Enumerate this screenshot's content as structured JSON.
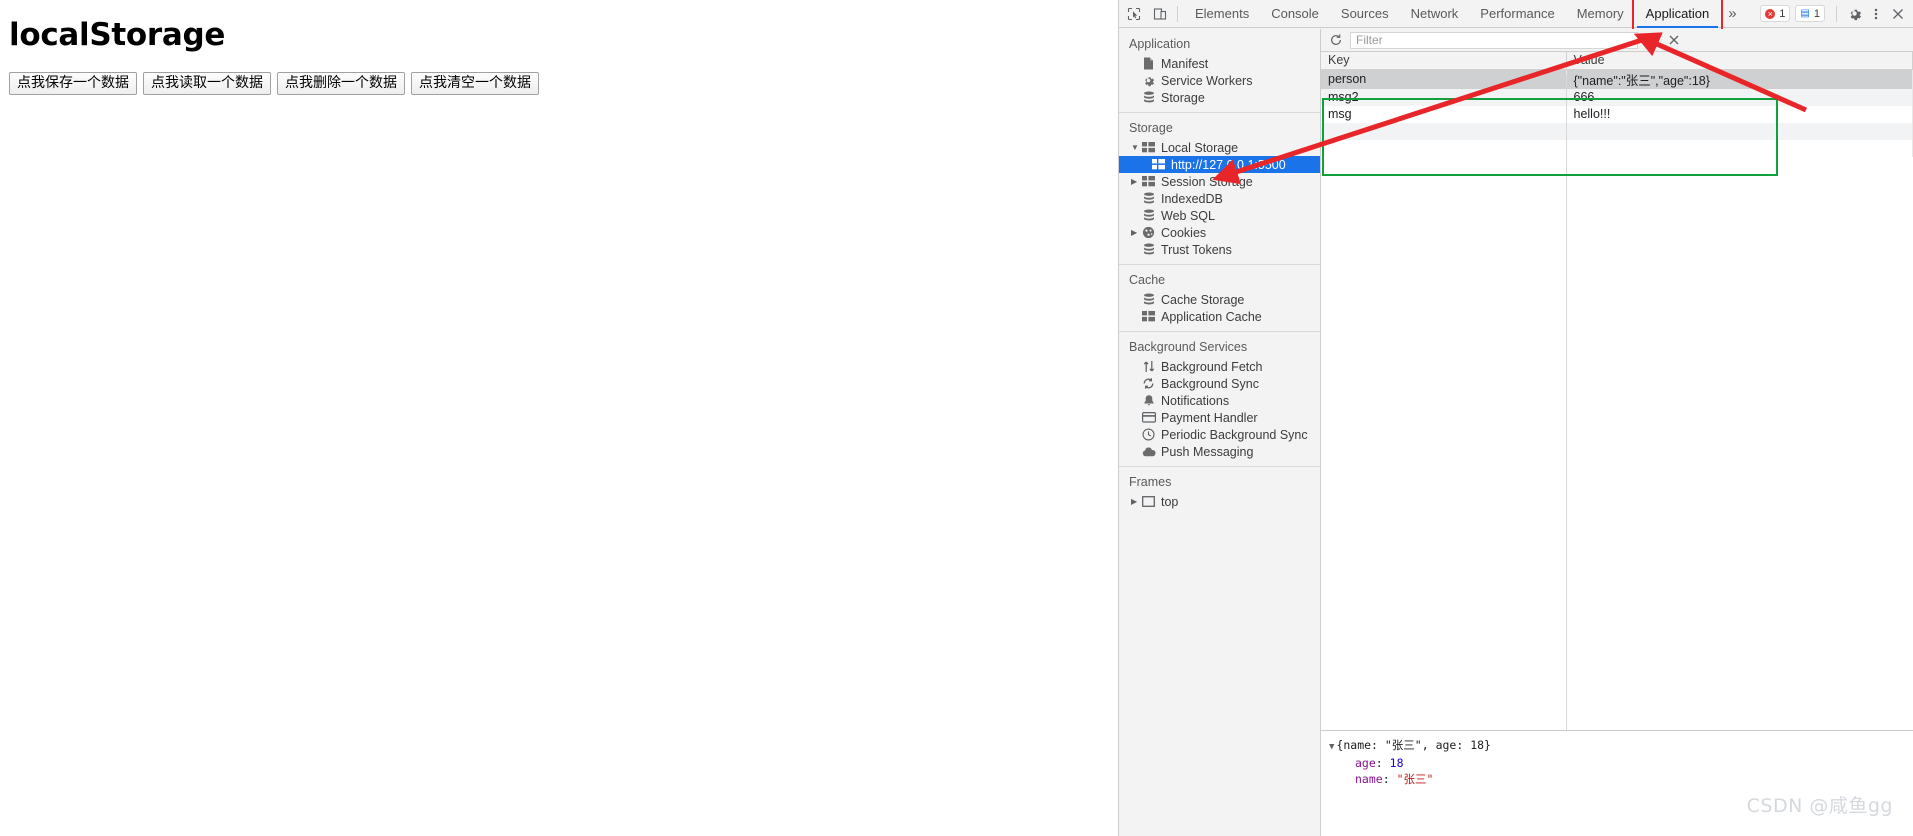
{
  "page": {
    "title": "localStorage",
    "buttons": [
      {
        "label": "点我保存一个数据",
        "name": "save-data-button"
      },
      {
        "label": "点我读取一个数据",
        "name": "read-data-button"
      },
      {
        "label": "点我删除一个数据",
        "name": "delete-data-button"
      },
      {
        "label": "点我清空一个数据",
        "name": "clear-data-button"
      }
    ]
  },
  "devtools": {
    "toolbar_left_icons": [
      "inspect-element-icon",
      "device-toolbar-icon"
    ],
    "tabs": [
      {
        "label": "Elements",
        "active": false
      },
      {
        "label": "Console",
        "active": false
      },
      {
        "label": "Sources",
        "active": false
      },
      {
        "label": "Network",
        "active": false
      },
      {
        "label": "Performance",
        "active": false
      },
      {
        "label": "Memory",
        "active": false
      },
      {
        "label": "Application",
        "active": true
      }
    ],
    "more_tabs": "»",
    "errors": {
      "icon": "error-icon",
      "count": "1"
    },
    "messages": {
      "icon": "message-icon",
      "count": "1"
    },
    "settings_icon": "gear-icon",
    "kebab_icon": "more-options-icon",
    "close_icon": "close-icon",
    "highlight_color": "#e8262a",
    "accent_color": "#1a73e8"
  },
  "sidebar": {
    "groups": [
      {
        "head": "Application",
        "items": [
          {
            "label": "Manifest",
            "icon": "manifest-file-icon",
            "indent": 0,
            "twisty": "",
            "selected": false
          },
          {
            "label": "Service Workers",
            "icon": "gear-icon",
            "indent": 0,
            "twisty": "",
            "selected": false
          },
          {
            "label": "Storage",
            "icon": "database-icon",
            "indent": 0,
            "twisty": "",
            "selected": false
          }
        ]
      },
      {
        "head": "Storage",
        "items": [
          {
            "label": "Local Storage",
            "icon": "table-grid-icon",
            "indent": 0,
            "twisty": "▼",
            "selected": false
          },
          {
            "label": "http://127.0.0.1:5500",
            "icon": "table-grid-icon",
            "indent": 1,
            "twisty": "",
            "selected": true
          },
          {
            "label": "Session Storage",
            "icon": "table-grid-icon",
            "indent": 0,
            "twisty": "▶",
            "selected": false
          },
          {
            "label": "IndexedDB",
            "icon": "database-icon",
            "indent": 0,
            "twisty": "",
            "selected": false
          },
          {
            "label": "Web SQL",
            "icon": "database-icon",
            "indent": 0,
            "twisty": "",
            "selected": false
          },
          {
            "label": "Cookies",
            "icon": "cookie-icon",
            "indent": 0,
            "twisty": "▶",
            "selected": false
          },
          {
            "label": "Trust Tokens",
            "icon": "database-icon",
            "indent": 0,
            "twisty": "",
            "selected": false
          }
        ]
      },
      {
        "head": "Cache",
        "items": [
          {
            "label": "Cache Storage",
            "icon": "database-icon",
            "indent": 0,
            "twisty": "",
            "selected": false
          },
          {
            "label": "Application Cache",
            "icon": "table-grid-icon",
            "indent": 0,
            "twisty": "",
            "selected": false
          }
        ]
      },
      {
        "head": "Background Services",
        "items": [
          {
            "label": "Background Fetch",
            "icon": "arrows-updown-icon",
            "indent": 0,
            "twisty": "",
            "selected": false
          },
          {
            "label": "Background Sync",
            "icon": "sync-icon",
            "indent": 0,
            "twisty": "",
            "selected": false
          },
          {
            "label": "Notifications",
            "icon": "bell-icon",
            "indent": 0,
            "twisty": "",
            "selected": false
          },
          {
            "label": "Payment Handler",
            "icon": "credit-card-icon",
            "indent": 0,
            "twisty": "",
            "selected": false
          },
          {
            "label": "Periodic Background Sync",
            "icon": "clock-icon",
            "indent": 0,
            "twisty": "",
            "selected": false
          },
          {
            "label": "Push Messaging",
            "icon": "cloud-icon",
            "indent": 0,
            "twisty": "",
            "selected": false
          }
        ]
      },
      {
        "head": "Frames",
        "items": [
          {
            "label": "top",
            "icon": "frame-icon",
            "indent": 0,
            "twisty": "▶",
            "selected": false
          }
        ]
      }
    ]
  },
  "storage_toolbar": {
    "refresh_icon": "refresh-icon",
    "filter_placeholder": "Filter",
    "filter_value": "",
    "clear_all_icon": "clear-all-icon",
    "delete_selected_icon": "delete-selected-icon"
  },
  "kv_table": {
    "columns": [
      "Key",
      "Value"
    ],
    "rows": [
      {
        "key": "person",
        "value": "{\"name\":\"张三\",\"age\":18}",
        "selected": true
      },
      {
        "key": "msg2",
        "value": "666",
        "selected": false
      },
      {
        "key": "msg",
        "value": "hello!!!",
        "selected": false
      }
    ],
    "highlight_color": "#12a03c"
  },
  "preview": {
    "root_twisty": "▼",
    "root_summary": "{name: \"张三\", age: 18}",
    "props": [
      {
        "key": "age",
        "value": "18",
        "kind": "number"
      },
      {
        "key": "name",
        "value": "\"张三\"",
        "kind": "string"
      }
    ]
  },
  "watermark": "CSDN @咸鱼gg"
}
